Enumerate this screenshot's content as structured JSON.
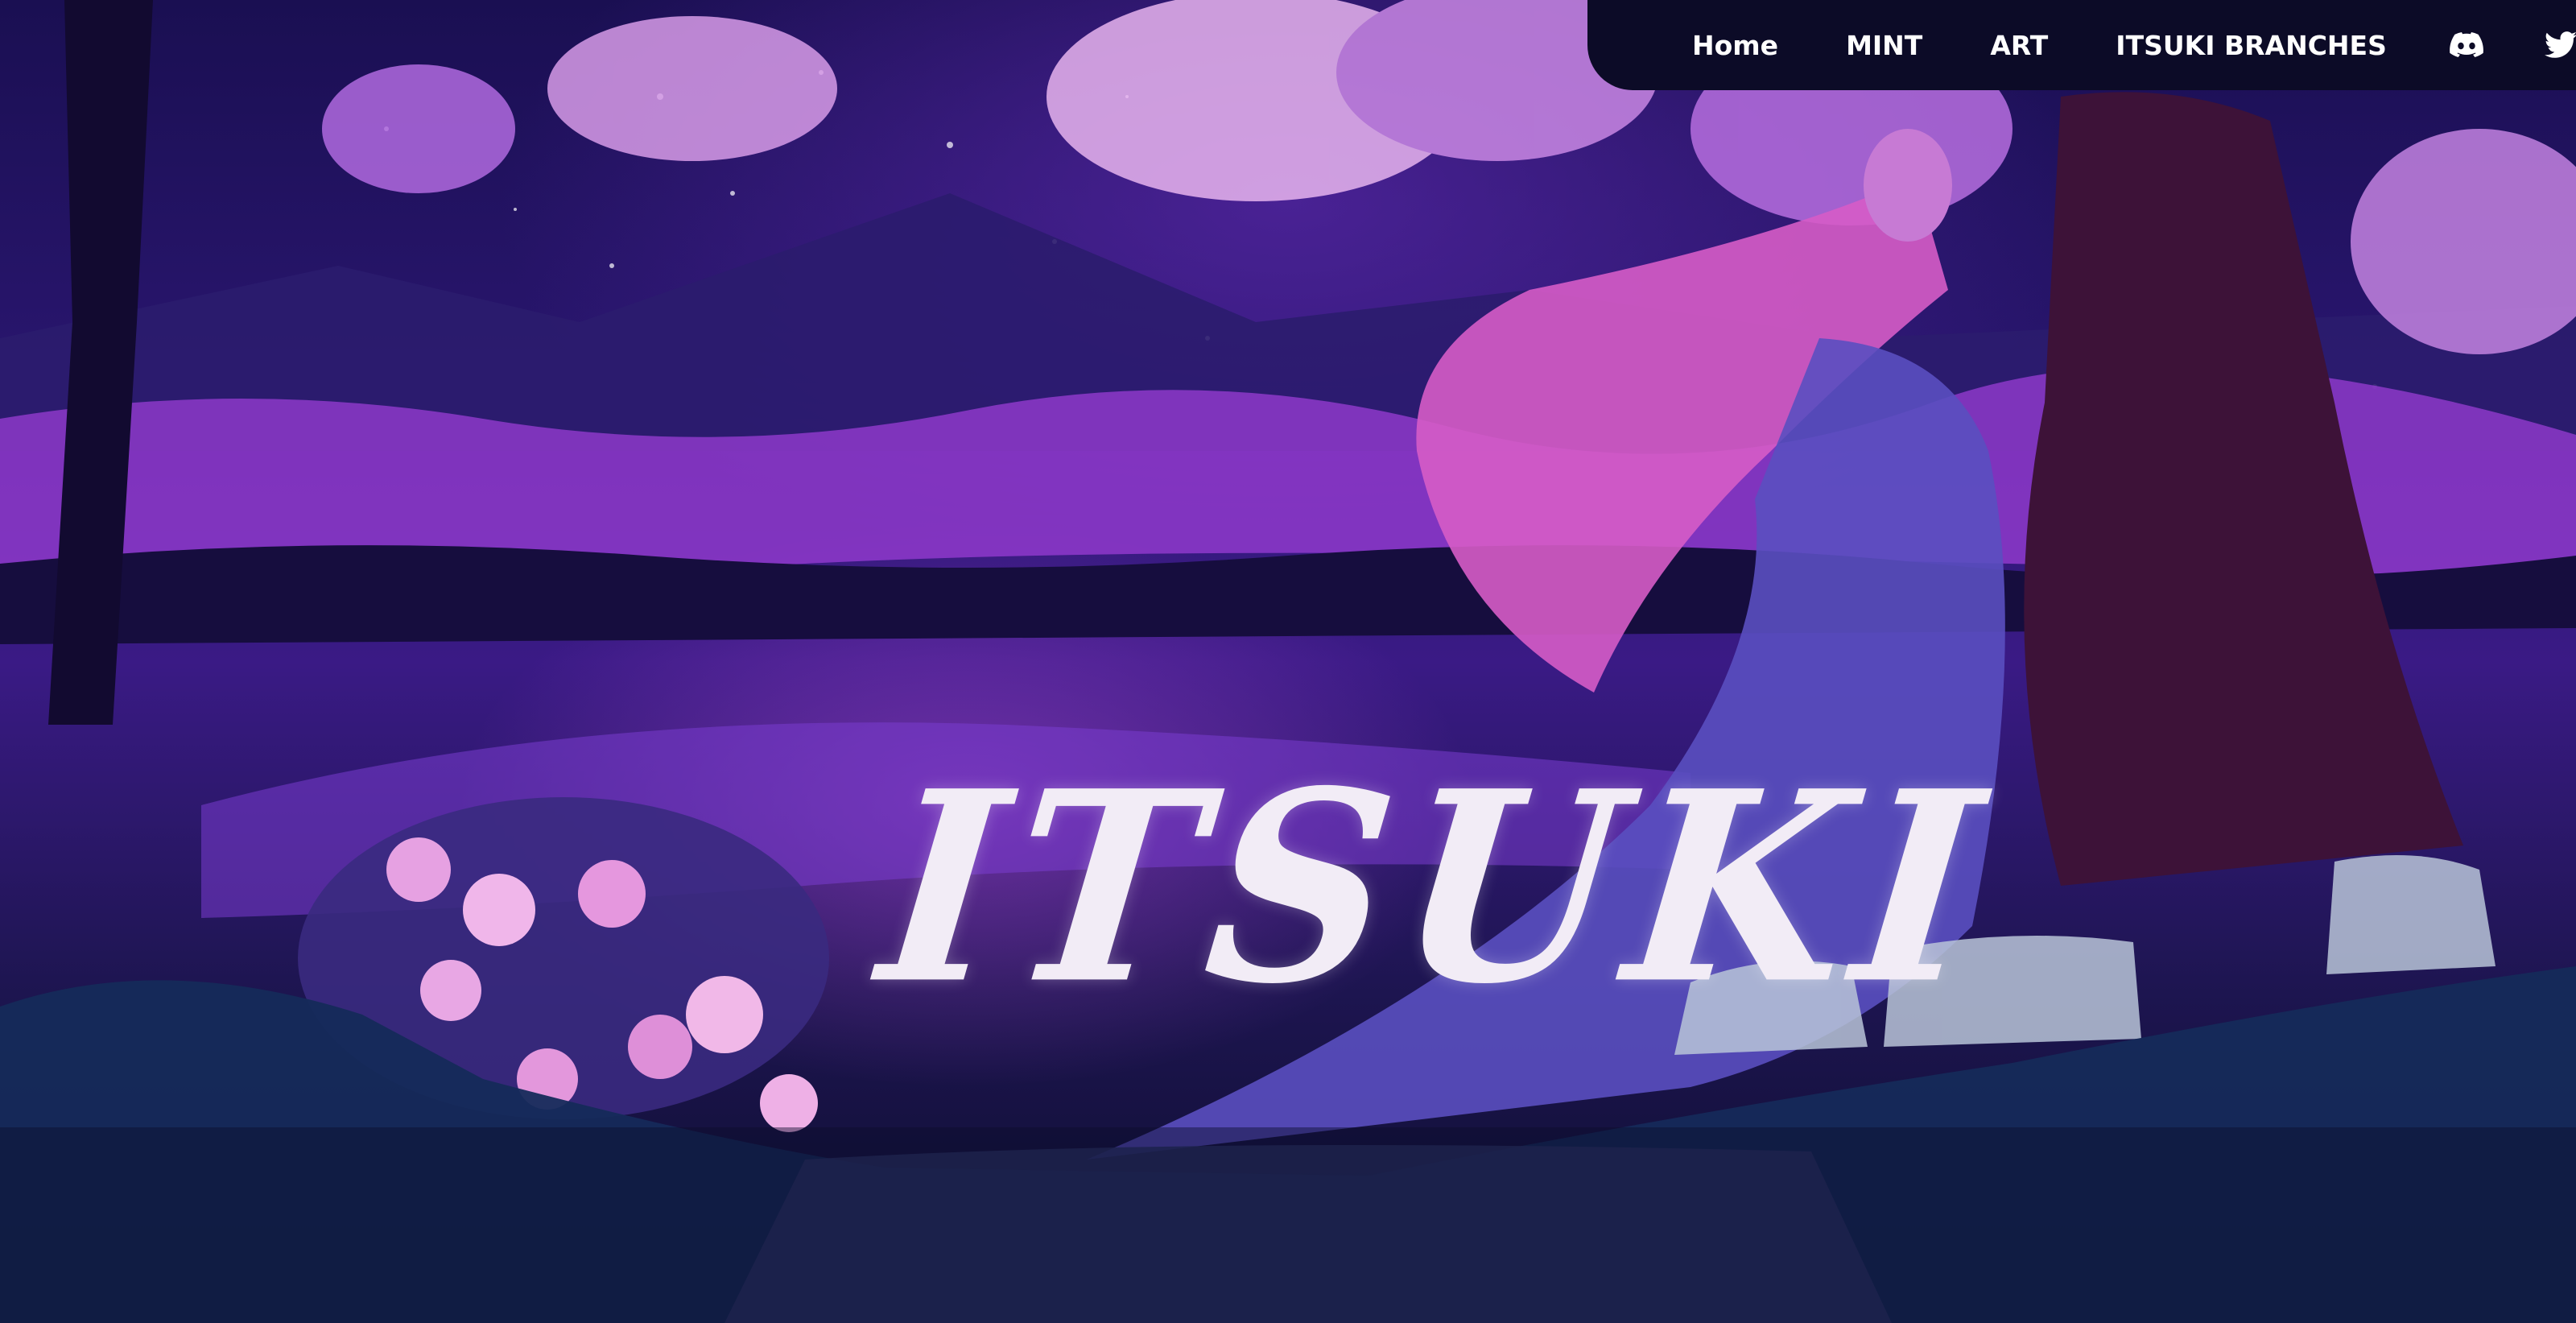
{
  "nav": {
    "links": [
      {
        "label": "Home"
      },
      {
        "label": "MINT"
      },
      {
        "label": "ART"
      },
      {
        "label": "ITSUKI BRANCHES"
      }
    ],
    "icons": [
      {
        "name": "discord-icon"
      },
      {
        "name": "twitter-icon"
      }
    ]
  },
  "hero": {
    "title": "ITSUKI"
  },
  "colors": {
    "nav_background": "#0c0b27",
    "title_text": "#f2ecf6",
    "accent_purple": "#8a3fd1",
    "accent_pink": "#e07ad8"
  }
}
